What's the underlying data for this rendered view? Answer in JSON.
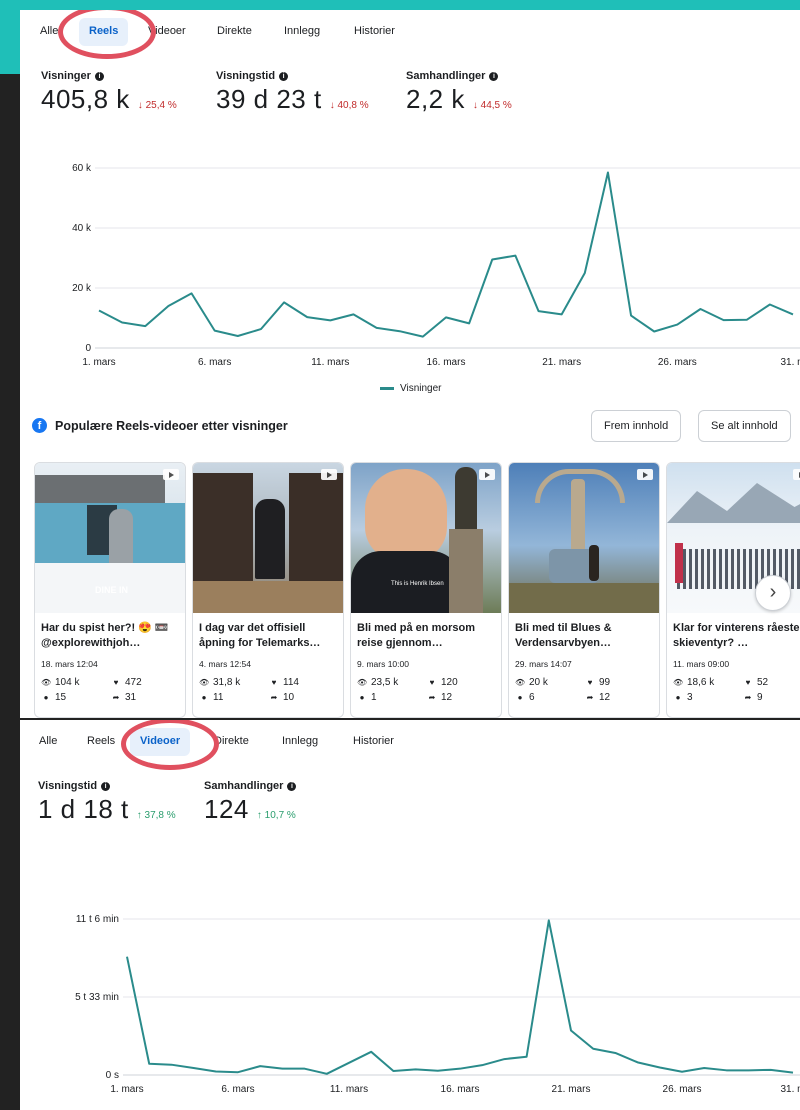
{
  "tabs": [
    "Alle",
    "Reels",
    "Videoer",
    "Direkte",
    "Innlegg",
    "Historier"
  ],
  "panel1": {
    "active_tab": "Reels",
    "metrics": [
      {
        "label": "Visninger",
        "value": "405,8 k",
        "change": "↓ 25,4 %",
        "direction": "down"
      },
      {
        "label": "Visningstid",
        "value": "39 d 23 t",
        "change": "↓ 40,8 %",
        "direction": "down"
      },
      {
        "label": "Samhandlinger",
        "value": "2,2 k",
        "change": "↓ 44,5 %",
        "direction": "down"
      }
    ],
    "legend": "Visninger"
  },
  "panel2": {
    "active_tab": "Videoer",
    "metrics": [
      {
        "label": "Visningstid",
        "value": "1 d 18 t",
        "change": "↑ 37,8 %",
        "direction": "up"
      },
      {
        "label": "Samhandlinger",
        "value": "124",
        "change": "↑ 10,7 %",
        "direction": "up"
      }
    ]
  },
  "section": {
    "title": "Populære Reels-videoer etter visninger",
    "promote_button": "Frem innhold",
    "see_all_button": "Se alt innhold"
  },
  "cards": [
    {
      "title": "Har du spist her?! 😍 📼 @explorewithjoh…",
      "date": "18. mars 12:04",
      "views": "104 k",
      "likes": "472",
      "comments": "15",
      "shares": "31",
      "overlay": "DINE IN"
    },
    {
      "title": "I dag var det offisiell åpning for Telemarks…",
      "date": "4. mars 12:54",
      "views": "31,8 k",
      "likes": "114",
      "comments": "11",
      "shares": "10",
      "overlay": ""
    },
    {
      "title": "Bli med på en morsom reise gjennom…",
      "date": "9. mars 10:00",
      "views": "23,5 k",
      "likes": "120",
      "comments": "1",
      "shares": "12",
      "overlay": "This is Henrik Ibsen"
    },
    {
      "title": "Bli med til Blues & Verdensarvbyen…",
      "date": "29. mars 14:07",
      "views": "20 k",
      "likes": "99",
      "comments": "6",
      "shares": "12",
      "overlay": ""
    },
    {
      "title": "Klar for vinterens råeste skieventyr? …",
      "date": "11. mars 09:00",
      "views": "18,6 k",
      "likes": "52",
      "comments": "3",
      "shares": "9",
      "overlay": ""
    }
  ],
  "colors": {
    "line": "#2a8b8b",
    "active_tab_bg": "#e7f0fb",
    "active_tab_text": "#0a62c9",
    "down": "#c12b2b",
    "up": "#2a9d6d",
    "highlight_circle": "#e0505f"
  },
  "chart_data": [
    {
      "type": "line",
      "xlabel": "",
      "ylabel": "",
      "x_tick_labels": [
        "1. mars",
        "6. mars",
        "11. mars",
        "16. mars",
        "21. mars",
        "26. mars",
        "31. m"
      ],
      "y_tick_labels": [
        "0",
        "20 k",
        "40 k",
        "60 k"
      ],
      "ylim": [
        0,
        60000
      ],
      "x": [
        1,
        2,
        3,
        4,
        5,
        6,
        7,
        8,
        9,
        10,
        11,
        12,
        13,
        14,
        15,
        16,
        17,
        18,
        19,
        20,
        21,
        22,
        23,
        24,
        25,
        26,
        27,
        28,
        29,
        30,
        31
      ],
      "series": [
        {
          "name": "Visninger",
          "values": [
            12500,
            8500,
            7300,
            14000,
            18200,
            5800,
            4000,
            6300,
            15200,
            10300,
            9200,
            11200,
            6700,
            5600,
            3800,
            10200,
            8200,
            29500,
            30800,
            12300,
            11200,
            25000,
            58500,
            10800,
            5500,
            7800,
            13000,
            9300,
            9400,
            14500,
            11200
          ]
        }
      ],
      "legend": "bottom"
    },
    {
      "type": "line",
      "xlabel": "",
      "ylabel": "",
      "x_tick_labels": [
        "1. mars",
        "6. mars",
        "11. mars",
        "16. mars",
        "21. mars",
        "26. mars",
        "31. m"
      ],
      "y_tick_labels": [
        "0 s",
        "5 t 33 min",
        "11 t 6 min"
      ],
      "y_unit": "minutes",
      "ylim": [
        0,
        666
      ],
      "x": [
        1,
        2,
        3,
        4,
        5,
        6,
        7,
        8,
        9,
        10,
        11,
        12,
        13,
        14,
        15,
        16,
        17,
        18,
        19,
        20,
        21,
        22,
        23,
        24,
        25,
        26,
        27,
        28,
        29,
        30,
        31
      ],
      "series": [
        {
          "values": [
            505,
            48,
            44,
            30,
            15,
            12,
            38,
            27,
            27,
            5,
            52,
            99,
            17,
            24,
            18,
            27,
            42,
            68,
            78,
            660,
            190,
            112,
            94,
            54,
            32,
            14,
            30,
            20,
            20,
            22,
            10
          ]
        }
      ]
    }
  ]
}
